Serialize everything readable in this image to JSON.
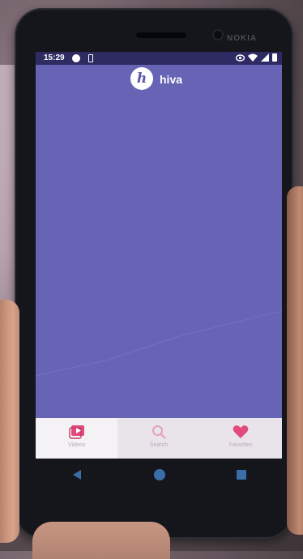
{
  "status_bar": {
    "time": "15:29"
  },
  "app": {
    "logo_letter": "h",
    "name": "hiva"
  },
  "device": {
    "brand": "NOKIA"
  },
  "bottom_nav": {
    "items": [
      {
        "label": "Videos",
        "icon": "video-icon",
        "active": true
      },
      {
        "label": "Search",
        "icon": "search-icon",
        "active": false
      },
      {
        "label": "Favorites",
        "icon": "heart-icon",
        "active": false
      }
    ]
  },
  "colors": {
    "screen_bg": "#6764b6",
    "status_bar_bg": "#2e2b62",
    "accent_pink": "#e14a7a",
    "nav_bg": "#e9e4ea",
    "android_nav": "#3a6ea8"
  }
}
